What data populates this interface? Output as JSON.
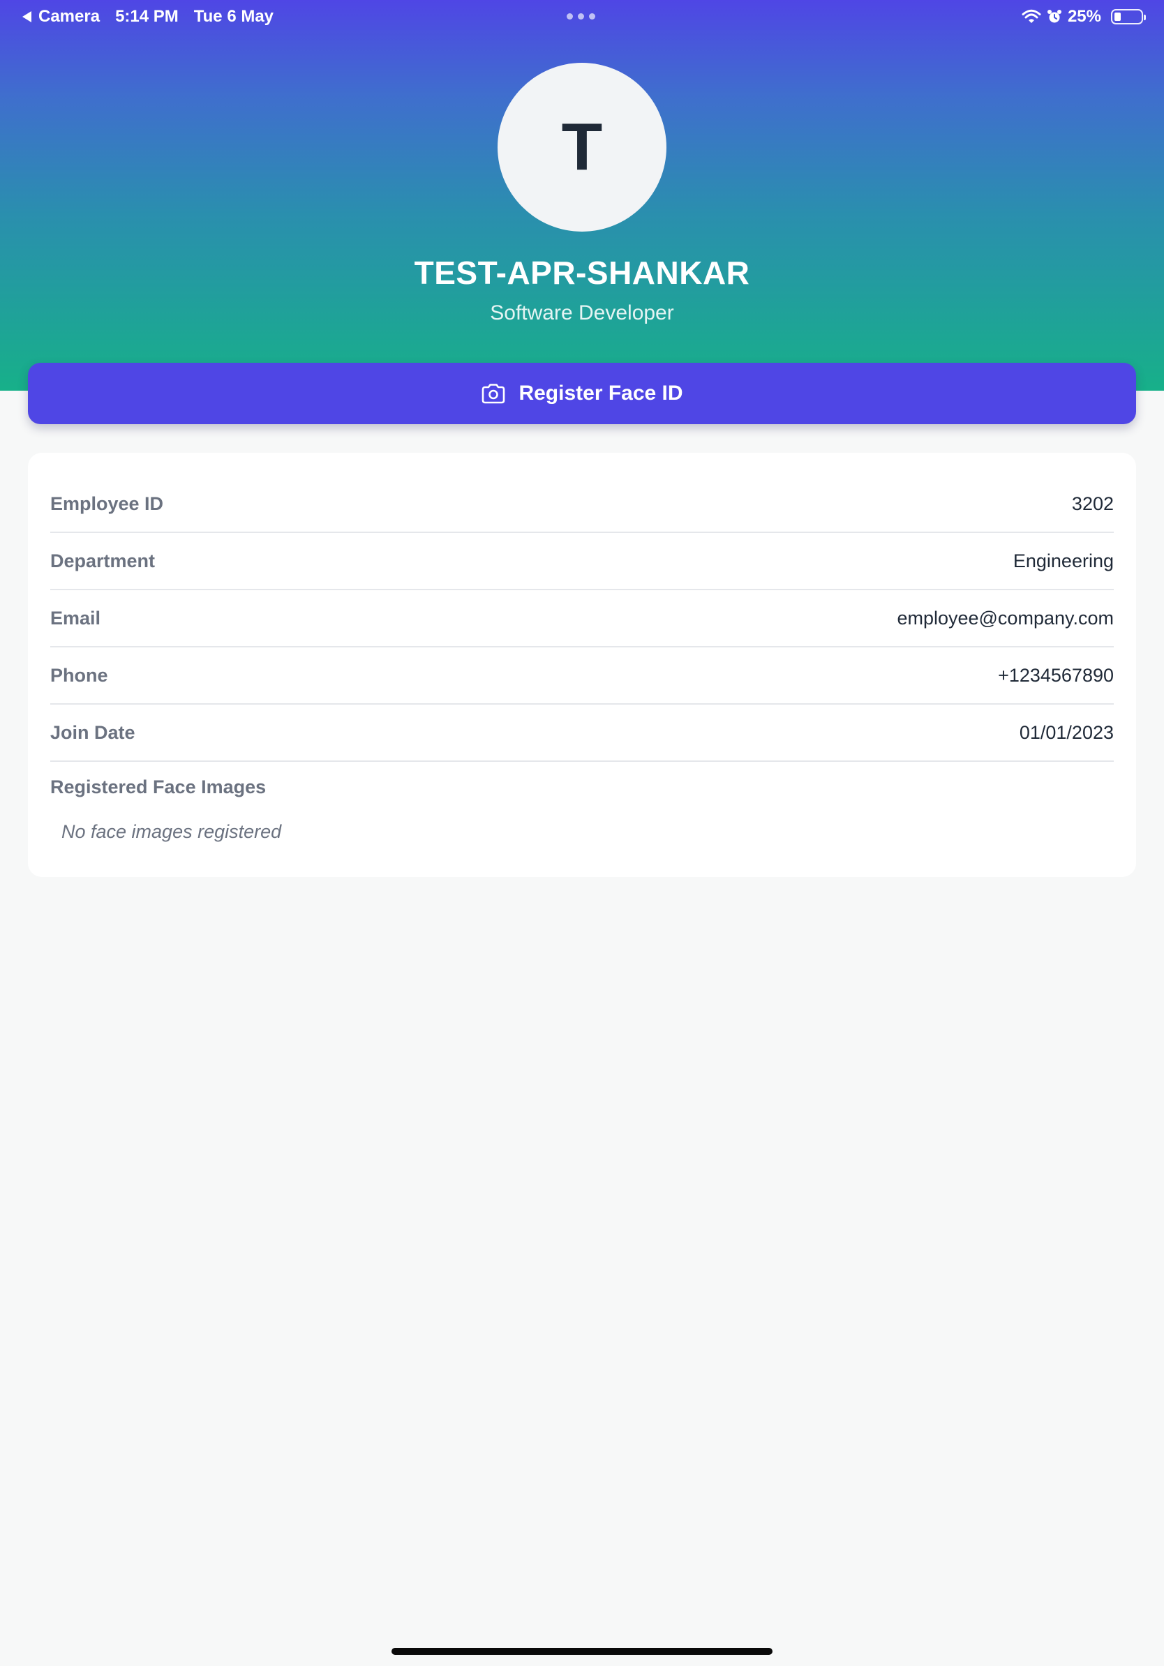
{
  "status_bar": {
    "back_app": "Camera",
    "time": "5:14 PM",
    "date": "Tue 6 May",
    "battery_text": "25%",
    "battery_level": 0.25,
    "icons": [
      "wifi-icon",
      "alarm-icon",
      "battery-icon"
    ]
  },
  "profile": {
    "initial": "T",
    "name": "TEST-APR-SHANKAR",
    "role": "Software Developer"
  },
  "register_button": {
    "label": "Register Face ID",
    "icon": "camera-icon"
  },
  "details": [
    {
      "label": "Employee ID",
      "value": "3202"
    },
    {
      "label": "Department",
      "value": "Engineering"
    },
    {
      "label": "Email",
      "value": "employee@company.com"
    },
    {
      "label": "Phone",
      "value": "+1234567890"
    },
    {
      "label": "Join Date",
      "value": "01/01/2023"
    }
  ],
  "face_images": {
    "label": "Registered Face Images",
    "empty_text": "No face images registered"
  },
  "colors": {
    "gradient_top": "#4f46e5",
    "gradient_bottom": "#17b089",
    "primary_button": "#4f46e5",
    "label_gray": "#6b7280",
    "value_dark": "#1f2937"
  }
}
